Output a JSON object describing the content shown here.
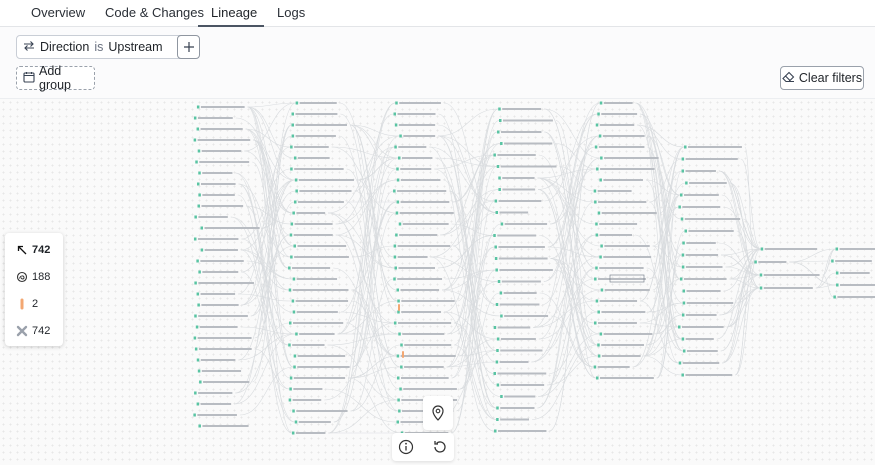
{
  "tabs": [
    {
      "label": "Overview",
      "active": false
    },
    {
      "label": "Code & Changes",
      "active": false
    },
    {
      "label": "Lineage",
      "active": true
    },
    {
      "label": "Logs",
      "active": false
    }
  ],
  "filter": {
    "field": "Direction",
    "operator": "is",
    "value": "Upstream"
  },
  "add_group_label": "Add group",
  "clear_filters_label": "Clear filters",
  "stats": [
    {
      "icon": "arrow-up-left-icon",
      "value": "742",
      "bold": true
    },
    {
      "icon": "model-icon",
      "value": "188",
      "bold": false
    },
    {
      "icon": "source-bar-icon",
      "value": "2",
      "bold": false
    },
    {
      "icon": "cross-icon",
      "value": "742",
      "bold": false
    }
  ],
  "colors": {
    "node_port": "#59c4a3",
    "edge": "#d9dcdf",
    "source_bar": "#f3a772"
  }
}
